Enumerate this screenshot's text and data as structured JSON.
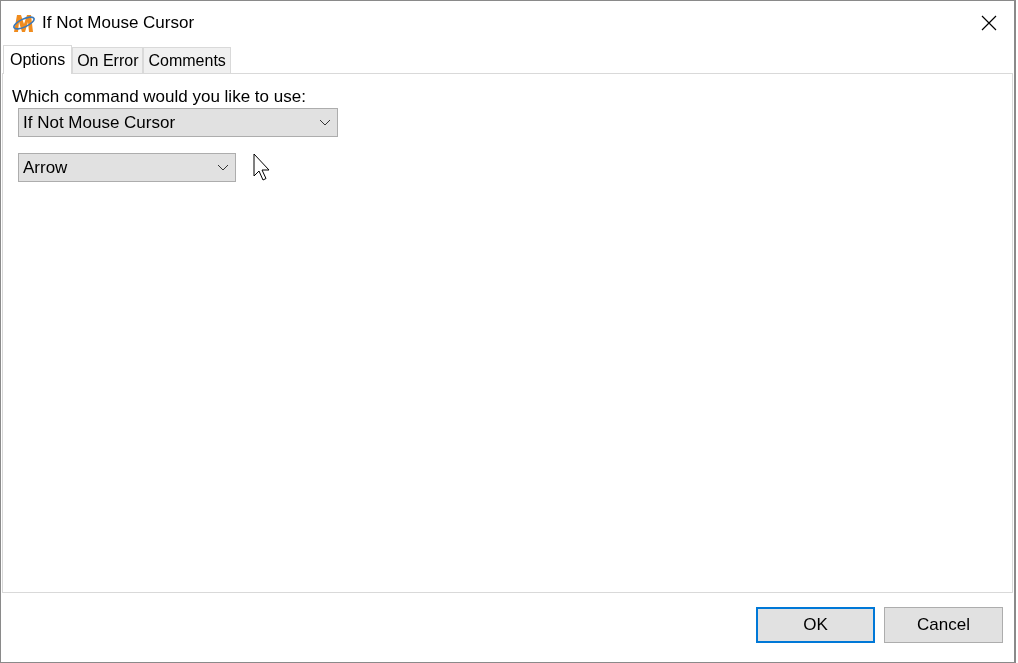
{
  "window": {
    "title": "If Not Mouse Cursor"
  },
  "tabs": [
    {
      "label": "Options",
      "selected": true
    },
    {
      "label": "On Error",
      "selected": false
    },
    {
      "label": "Comments",
      "selected": false
    }
  ],
  "options": {
    "prompt": "Which command would you like to use:",
    "command": {
      "value": "If Not Mouse Cursor"
    },
    "cursor": {
      "value": "Arrow"
    }
  },
  "buttons": [
    {
      "label": "OK",
      "focused": true
    },
    {
      "label": "Cancel",
      "focused": false
    }
  ]
}
